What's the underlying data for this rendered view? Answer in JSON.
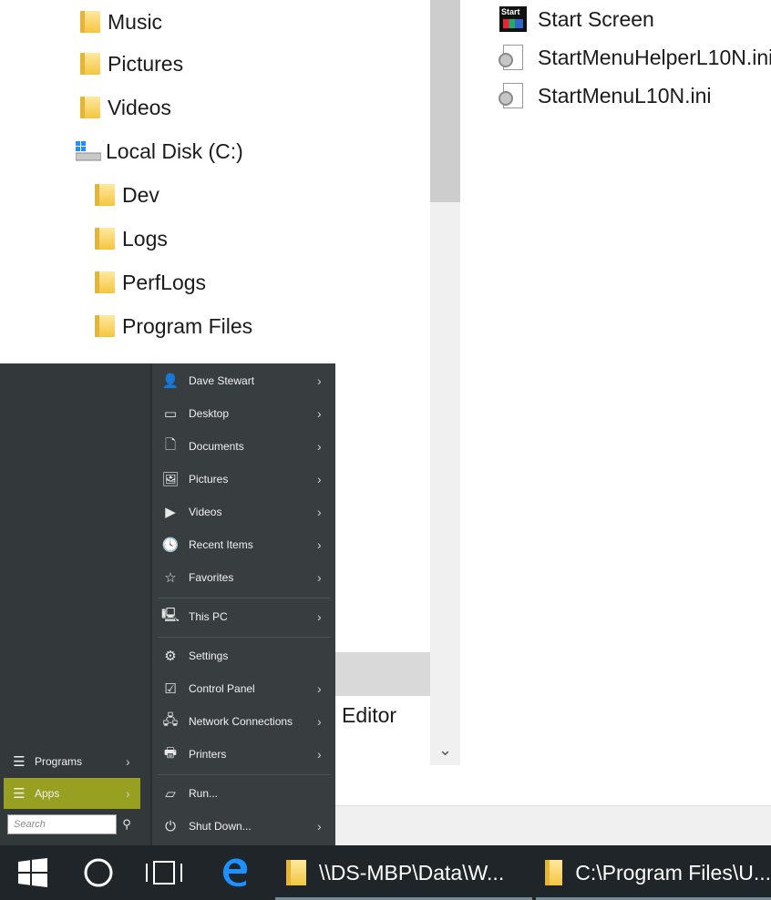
{
  "explorer": {
    "nav_tree": [
      {
        "label": "Music",
        "icon": "music-folder-icon"
      },
      {
        "label": "Pictures",
        "icon": "pictures-folder-icon"
      },
      {
        "label": "Videos",
        "icon": "videos-folder-icon"
      },
      {
        "label": "Local Disk (C:)",
        "icon": "drive-icon"
      },
      {
        "label": "Dev",
        "icon": "folder-icon"
      },
      {
        "label": "Logs",
        "icon": "folder-icon"
      },
      {
        "label": "PerfLogs",
        "icon": "folder-icon"
      },
      {
        "label": "Program Files",
        "icon": "folder-icon"
      }
    ],
    "partial_tree_label": "Editor",
    "files": [
      {
        "name": "Start Screen",
        "icon": "start-screen-shortcut-icon"
      },
      {
        "name": "StartMenuHelperL10N.ini",
        "icon": "ini-file-icon"
      },
      {
        "name": "StartMenuL10N.ini",
        "icon": "ini-file-icon"
      }
    ],
    "start_icon_text": "Start"
  },
  "start_menu": {
    "right_items": [
      {
        "label": "Dave Stewart",
        "icon": "user-icon",
        "glyph": "👤",
        "arrow": "›"
      },
      {
        "label": "Desktop",
        "icon": "desktop-icon",
        "glyph": "▭",
        "arrow": "›"
      },
      {
        "label": "Documents",
        "icon": "document-icon",
        "glyph": "🗋",
        "arrow": "›"
      },
      {
        "label": "Pictures",
        "icon": "pictures-icon",
        "glyph": "🖼",
        "arrow": "›"
      },
      {
        "label": "Videos",
        "icon": "videos-icon",
        "glyph": "▶",
        "arrow": "›"
      },
      {
        "label": "Recent Items",
        "icon": "recent-items-icon",
        "glyph": "🕓",
        "arrow": "›"
      },
      {
        "label": "Favorites",
        "icon": "star-icon",
        "glyph": "☆",
        "arrow": "›"
      },
      {
        "label": "This PC",
        "icon": "computer-icon",
        "glyph": "🖳",
        "arrow": "›"
      },
      {
        "label": "Settings",
        "icon": "gear-icon",
        "glyph": "⚙",
        "arrow": ""
      },
      {
        "label": "Control Panel",
        "icon": "control-panel-icon",
        "glyph": "☑",
        "arrow": "›"
      },
      {
        "label": "Network Connections",
        "icon": "network-icon",
        "glyph": "🖧",
        "arrow": "›"
      },
      {
        "label": "Printers",
        "icon": "printer-icon",
        "glyph": "🖶",
        "arrow": "›"
      },
      {
        "label": "Run...",
        "icon": "run-icon",
        "glyph": "▱",
        "arrow": ""
      },
      {
        "label": "Shut Down...",
        "icon": "power-icon",
        "glyph": "⏻",
        "arrow": "›"
      }
    ],
    "left_items": [
      {
        "label": "Programs",
        "icon": "list-icon",
        "glyph": "☰",
        "arrow": "›"
      },
      {
        "label": "Apps",
        "icon": "list-icon",
        "glyph": "☰",
        "arrow": "›"
      }
    ],
    "search": {
      "placeholder": "Search",
      "icon": "search-icon"
    }
  },
  "taskbar": {
    "apps": [
      {
        "label": "\\\\DS-MBP\\Data\\W...",
        "icon": "folder-icon"
      },
      {
        "label": "C:\\Program Files\\U...",
        "icon": "folder-icon"
      }
    ],
    "accent": "#98a022"
  }
}
